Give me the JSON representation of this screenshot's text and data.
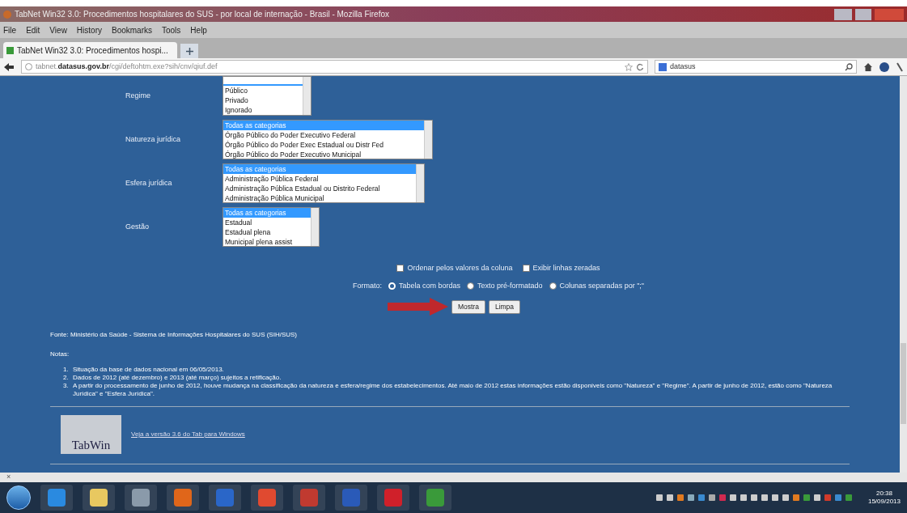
{
  "window": {
    "title": "TabNet Win32 3.0: Procedimentos hospitalares do SUS - por local de internação - Brasil - Mozilla Firefox"
  },
  "menu": [
    "File",
    "Edit",
    "View",
    "History",
    "Bookmarks",
    "Tools",
    "Help"
  ],
  "tabs": [
    {
      "label": "TabNet Win32 3.0: Procedimentos hospi...",
      "selected": true
    }
  ],
  "address": {
    "host": "tabnet.datasus.gov.br",
    "path": "/cgi/deftohtm.exe?sih/cnv/qiuf.def"
  },
  "search": {
    "value": "datasus"
  },
  "form": {
    "fields": [
      {
        "label": "Regime",
        "options": [
          {
            "text": "Público",
            "selected": false
          },
          {
            "text": "Privado",
            "selected": false
          },
          {
            "text": "Ignorado",
            "selected": false
          }
        ]
      },
      {
        "label": "Natureza jurídica",
        "options": [
          {
            "text": "Todas as categorias",
            "selected": true
          },
          {
            "text": "Órgão Público do Poder Executivo Federal",
            "selected": false
          },
          {
            "text": "Órgão Público do Poder Exec Estadual ou Distr Fed",
            "selected": false
          },
          {
            "text": "Órgão Público do Poder Executivo Municipal",
            "selected": false
          }
        ]
      },
      {
        "label": "Esfera jurídica",
        "options": [
          {
            "text": "Todas as categorias",
            "selected": true
          },
          {
            "text": "Administração Pública Federal",
            "selected": false
          },
          {
            "text": "Administração Pública Estadual ou Distrito Federal",
            "selected": false
          },
          {
            "text": "Administração Pública Municipal",
            "selected": false
          }
        ]
      },
      {
        "label": "Gestão",
        "options": [
          {
            "text": "Todas as categorias",
            "selected": true
          },
          {
            "text": "Estadual",
            "selected": false
          },
          {
            "text": "Estadual plena",
            "selected": false
          },
          {
            "text": "Municipal plena assist",
            "selected": false
          }
        ]
      }
    ],
    "checkboxes": [
      {
        "label": "Ordenar pelos valores da coluna",
        "checked": false
      },
      {
        "label": "Exibir linhas zeradas",
        "checked": false
      }
    ],
    "format": {
      "label": "Formato:",
      "options": [
        {
          "label": "Tabela com bordas",
          "selected": true
        },
        {
          "label": "Texto pré-formatado",
          "selected": false
        },
        {
          "label": "Colunas separadas por \";\"",
          "selected": false
        }
      ]
    },
    "buttons": [
      "Mostra",
      "Limpa"
    ]
  },
  "source": "Fonte: Ministério da Saúde - Sistema de Informações Hospitalares do SUS (SIH/SUS)",
  "notes_heading": "Notas:",
  "notes": [
    {
      "number": "1.",
      "text": "Situação da base de dados nacional em 06/05/2013."
    },
    {
      "number": "2.",
      "text": "Dados de 2012 (até dezembro) e 2013 (até março) sujeitos a retificação."
    },
    {
      "number": "3.",
      "text": "A partir do processamento de junho de 2012, houve mudança na classificação da natureza e esfera/regime dos estabelecimentos. Até maio de 2012 estas informações estão disponíveis como \"Natureza\" e \"Regime\". A partir de junho de 2012, estão como \"Natureza Jurídica\" e \"Esfera Jurídica\"."
    }
  ],
  "tabwin": {
    "logo": "TabWin",
    "link": "Veja a versão 3.6 do Tab para Windows"
  },
  "status_bar": {
    "close": "×"
  },
  "clock": {
    "time": "20:38",
    "date": "15/09/2013"
  }
}
